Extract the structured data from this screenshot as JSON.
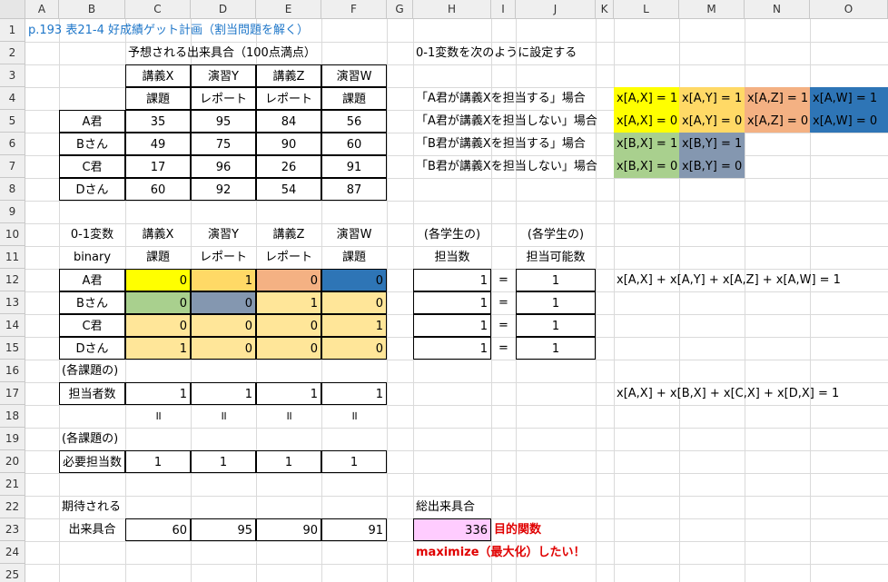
{
  "columns": [
    "A",
    "B",
    "C",
    "D",
    "E",
    "F",
    "G",
    "H",
    "I",
    "J",
    "K",
    "L",
    "M",
    "N",
    "O"
  ],
  "rows": [
    "1",
    "2",
    "3",
    "4",
    "5",
    "6",
    "7",
    "8",
    "9",
    "10",
    "11",
    "12",
    "13",
    "14",
    "15",
    "16",
    "17",
    "18",
    "19",
    "20",
    "21",
    "22",
    "23",
    "24",
    "25"
  ],
  "title": "p.193 表21-4 好成績ゲット計画（割当問題を解く）",
  "expected_table": {
    "heading": "予想される出来具合（100点満点）",
    "headers1": [
      "講義X",
      "演習Y",
      "講義Z",
      "演習W"
    ],
    "headers2": [
      "課題",
      "レポート",
      "レポート",
      "課題"
    ],
    "students": [
      "A君",
      "Bさん",
      "C君",
      "Dさん"
    ],
    "scores": [
      [
        35,
        95,
        84,
        56
      ],
      [
        49,
        75,
        90,
        60
      ],
      [
        17,
        96,
        26,
        91
      ],
      [
        60,
        92,
        54,
        87
      ]
    ]
  },
  "var_setup": {
    "heading": "0-1変数を次のように設定する",
    "lines": [
      "「A君が講義Xを担当する」場合",
      "「A君が講義Xを担当しない」場合",
      "「B君が講義Xを担当する」場合",
      "「B君が講義Xを担当しない」場合"
    ],
    "vars": [
      [
        "x[A,X] = 1",
        "x[A,Y] = 1",
        "x[A,Z] = 1",
        "x[A,W] = 1"
      ],
      [
        "x[A,X] = 0",
        "x[A,Y] = 0",
        "x[A,Z] = 0",
        "x[A,W] = 0"
      ],
      [
        "x[B,X] = 1",
        "x[B,Y] = 1"
      ],
      [
        "x[B,X] = 0",
        "x[B,Y] = 0"
      ]
    ]
  },
  "binary_table": {
    "label1": "0-1変数",
    "label2": "binary",
    "headers1": [
      "講義X",
      "演習Y",
      "講義Z",
      "演習W"
    ],
    "headers2": [
      "課題",
      "レポート",
      "レポート",
      "課題"
    ],
    "students": [
      "A君",
      "Bさん",
      "C君",
      "Dさん"
    ],
    "values": [
      [
        0,
        1,
        0,
        0
      ],
      [
        0,
        0,
        1,
        0
      ],
      [
        0,
        0,
        0,
        1
      ],
      [
        1,
        0,
        0,
        0
      ]
    ]
  },
  "student_constraint": {
    "h1": "(各学生の)",
    "h2": "担当数",
    "j1": "(各学生の)",
    "j2": "担当可能数",
    "counts": [
      1,
      1,
      1,
      1
    ],
    "eq": "=",
    "caps": [
      1,
      1,
      1,
      1
    ]
  },
  "equation_row": "x[A,X] + x[A,Y] + x[A,Z] + x[A,W] = 1",
  "equation_col": "x[A,X] + x[B,X] + x[C,X] + x[D,X] = 1",
  "task_constraint": {
    "label_a": "(各課題の)",
    "label_b": "担当者数",
    "counts": [
      1,
      1,
      1,
      1
    ],
    "eq": "॥",
    "label_c": "(各課題の)",
    "label_d": "必要担当数",
    "required": [
      1,
      1,
      1,
      1
    ]
  },
  "expected_result": {
    "label1": "期待される",
    "label2": "出来具合",
    "values": [
      60,
      95,
      90,
      91
    ]
  },
  "objective": {
    "label": "総出来具合",
    "value": 336,
    "tag": "目的関数",
    "note": "maximize（最大化）したい！"
  }
}
